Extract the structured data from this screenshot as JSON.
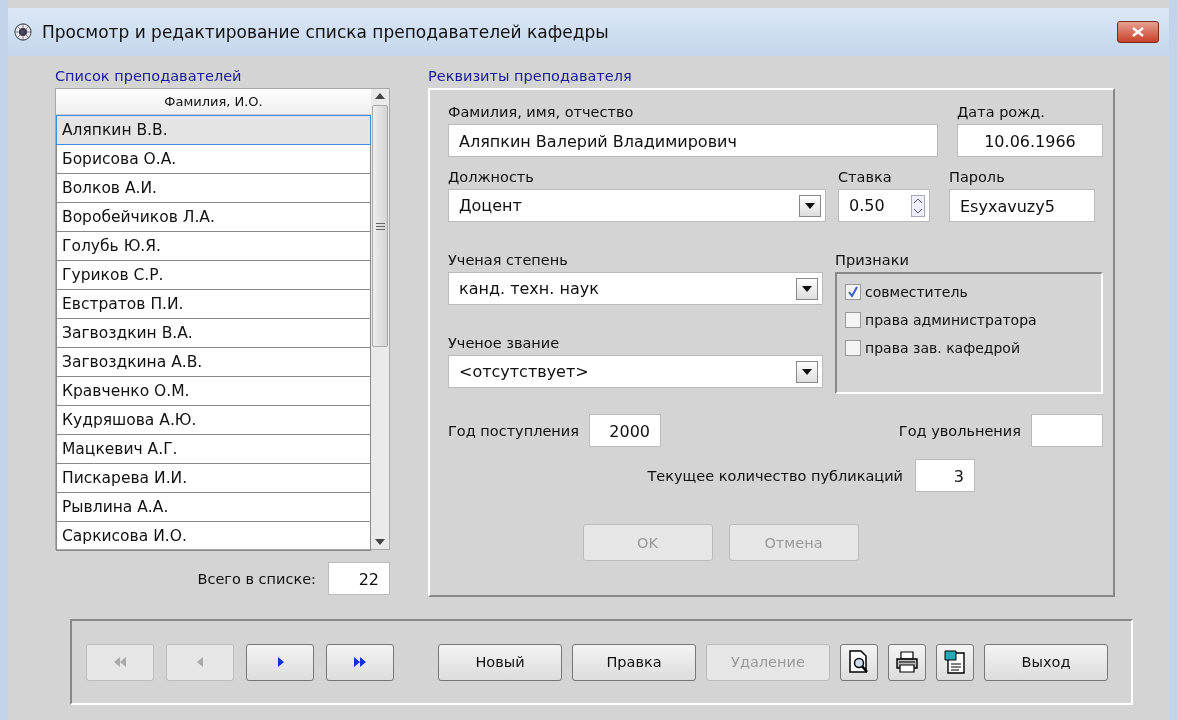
{
  "window": {
    "title": "Просмотр и редактирование списка преподавателей кафедры"
  },
  "list_panel": {
    "label": "Список преподавателей",
    "column": "Фамилия, И.О.",
    "rows": [
      {
        "name": "Аляпкин В.В.",
        "selected": true
      },
      {
        "name": "Борисова О.А.",
        "selected": false
      },
      {
        "name": "Волков А.И.",
        "selected": false
      },
      {
        "name": "Воробейчиков Л.А.",
        "selected": false
      },
      {
        "name": "Голубь Ю.Я.",
        "selected": false
      },
      {
        "name": "Гуриков С.Р.",
        "selected": false
      },
      {
        "name": "Евстратов П.И.",
        "selected": false
      },
      {
        "name": "Загвоздкин В.А.",
        "selected": false
      },
      {
        "name": "Загвоздкина А.В.",
        "selected": false
      },
      {
        "name": "Кравченко О.М.",
        "selected": false
      },
      {
        "name": "Кудряшова А.Ю.",
        "selected": false
      },
      {
        "name": "Мацкевич А.Г.",
        "selected": false
      },
      {
        "name": "Пискарева И.И.",
        "selected": false
      },
      {
        "name": "Рывлина А.А.",
        "selected": false
      },
      {
        "name": "Саркисова И.О.",
        "selected": false
      }
    ],
    "total_label": "Всего в списке:",
    "total_value": "22"
  },
  "details": {
    "label": "Реквизиты преподавателя",
    "full_name": {
      "label": "Фамилия, имя, отчество",
      "value": "Аляпкин Валерий Владимирович"
    },
    "birth_date": {
      "label": "Дата рожд.",
      "value": "10.06.1966"
    },
    "position": {
      "label": "Должность",
      "value": "Доцент"
    },
    "rate": {
      "label": "Ставка",
      "value": "0.50"
    },
    "password": {
      "label": "Пароль",
      "value": "Esyxavuzy5"
    },
    "degree": {
      "label": "Ученая степень",
      "value": "канд. техн. наук"
    },
    "title": {
      "label": "Ученое звание",
      "value": "<отсутствует>"
    },
    "flags": {
      "label": "Признаки",
      "items": [
        {
          "label": "совместитель",
          "checked": true
        },
        {
          "label": "права администратора",
          "checked": false
        },
        {
          "label": "права зав. кафедрой",
          "checked": false
        }
      ]
    },
    "hire_year": {
      "label": "Год поступления",
      "value": "2000"
    },
    "leave_year": {
      "label": "Год увольнения"
    },
    "publications": {
      "label": "Текущее количество публикаций",
      "value": "3"
    },
    "buttons": [
      {
        "label": "OK",
        "disabled": true
      },
      {
        "label": "Отмена",
        "disabled": true
      }
    ]
  },
  "toolbar": [
    {
      "kind": "first",
      "disabled": true
    },
    {
      "kind": "prev",
      "disabled": true
    },
    {
      "kind": "next",
      "disabled": false
    },
    {
      "kind": "last",
      "disabled": false
    },
    {
      "kind": "text",
      "label": "Новый",
      "disabled": false
    },
    {
      "kind": "text",
      "label": "Правка",
      "disabled": false
    },
    {
      "kind": "text",
      "label": "Удаление",
      "disabled": true
    },
    {
      "kind": "preview",
      "disabled": false
    },
    {
      "kind": "print",
      "disabled": false
    },
    {
      "kind": "export",
      "disabled": false
    },
    {
      "kind": "text",
      "label": "Выход",
      "disabled": false
    }
  ]
}
